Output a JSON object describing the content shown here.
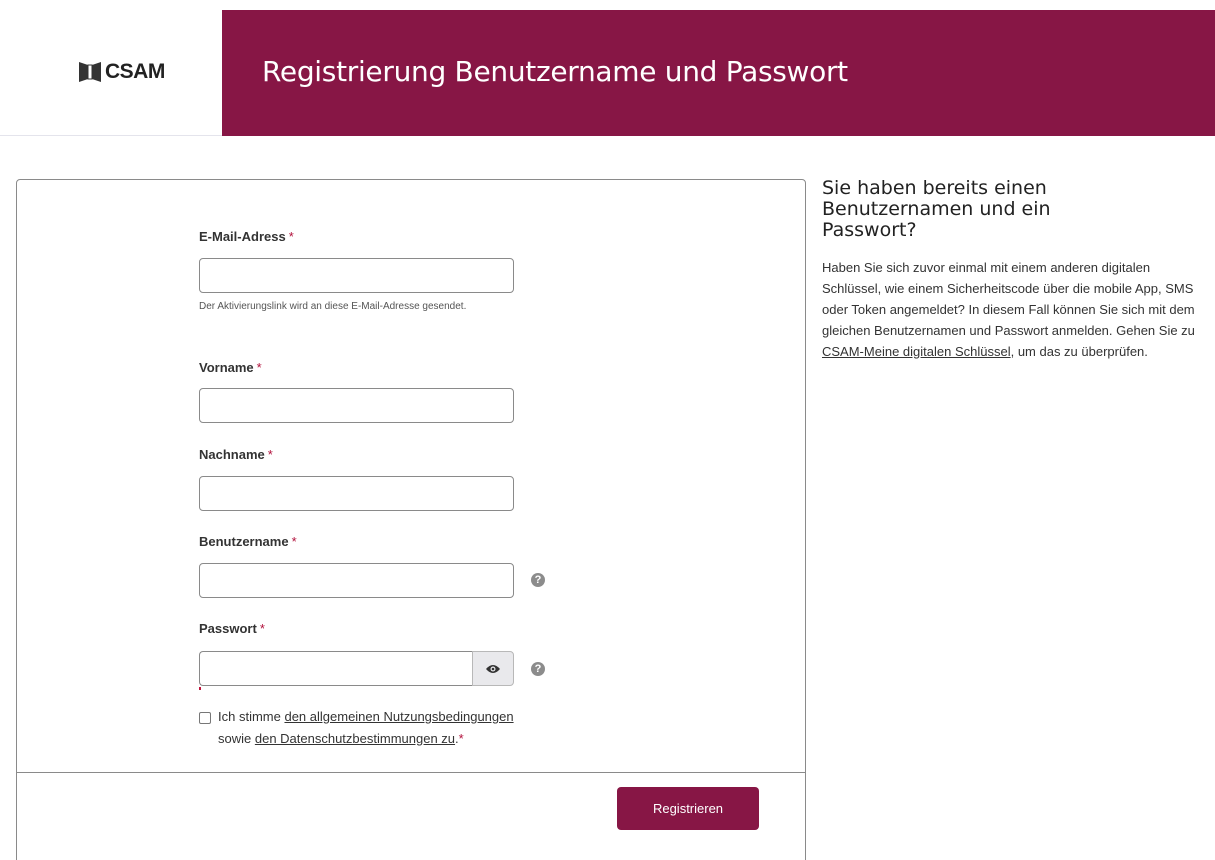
{
  "header": {
    "logo_text": "CSAM",
    "title": "Registrierung Benutzername und Passwort",
    "brand_color": "#871645"
  },
  "form": {
    "email": {
      "label": "E-Mail-Adress",
      "required_mark": "*",
      "value": "",
      "help": "Der Aktivierungslink wird an diese E-Mail-Adresse gesendet."
    },
    "firstname": {
      "label": "Vorname",
      "required_mark": "*",
      "value": ""
    },
    "lastname": {
      "label": "Nachname",
      "required_mark": "*",
      "value": ""
    },
    "username": {
      "label": "Benutzername",
      "required_mark": "*",
      "value": "",
      "help_icon": "question-circle-icon"
    },
    "password": {
      "label": "Passwort",
      "required_mark": "*",
      "value": "",
      "toggle_icon": "eye-icon",
      "help_icon": "question-circle-icon"
    },
    "terms": {
      "checked": false,
      "text_before": "Ich stimme ",
      "link1": "den allgemeinen Nutzungsbedingungen",
      "text_middle": "sowie ",
      "link2": "den Datenschutzbestimmungen zu",
      "text_after": ".",
      "required_mark": "*"
    },
    "submit_label": "Registrieren"
  },
  "sidebar": {
    "heading": "Sie haben bereits einen Benutzernamen und ein Passwort?",
    "body_before": "Haben Sie sich zuvor einmal mit einem anderen digitalen Schlüssel, wie einem Sicherheitscode über die mobile App, SMS oder Token angemeldet? In diesem Fall können Sie sich mit dem gleichen Benutzernamen und Passwort anmelden. Gehen Sie zu ",
    "link": "CSAM-Meine digitalen Schlüssel",
    "body_after": ", um das zu überprüfen."
  }
}
